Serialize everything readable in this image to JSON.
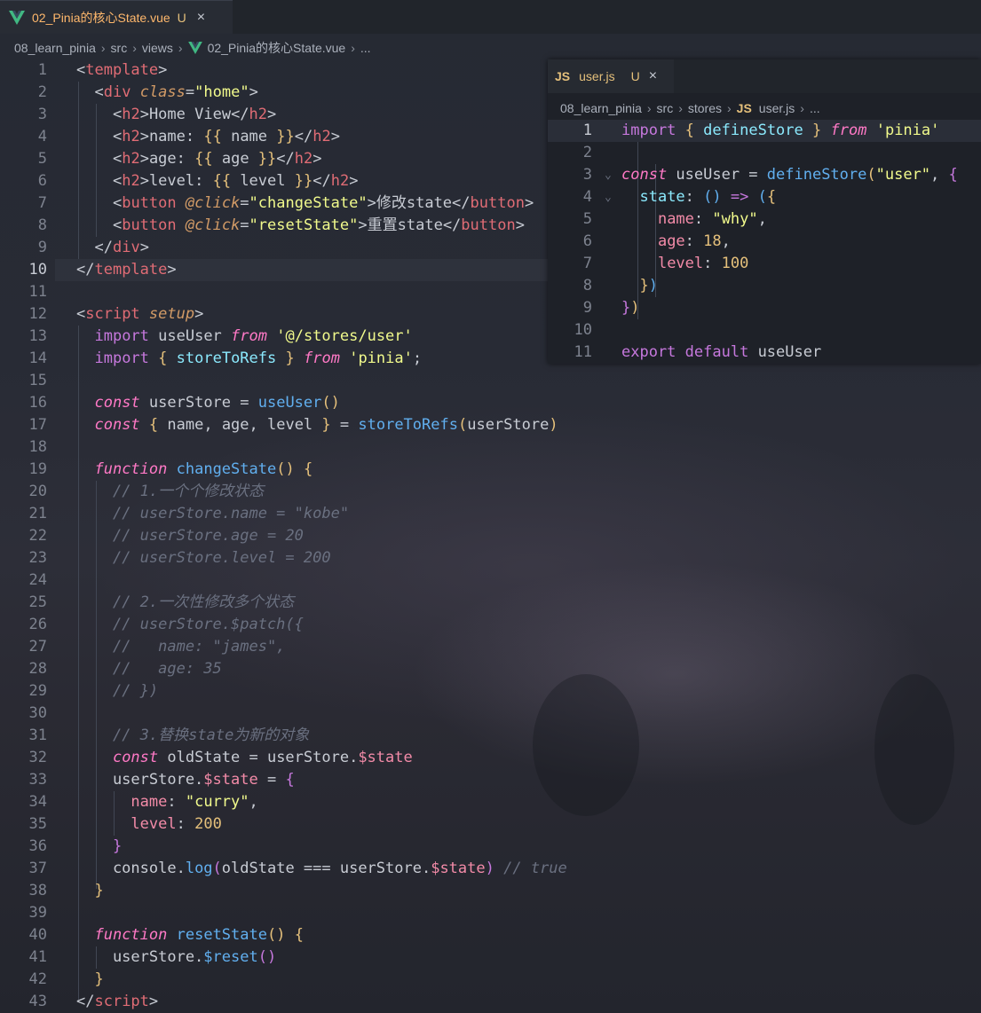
{
  "main_tab": {
    "title": "02_Pinia的核心State.vue",
    "status": "U",
    "close": "×"
  },
  "breadcrumb": [
    "08_learn_pinia",
    "src",
    "views",
    "02_Pinia的核心State.vue",
    "..."
  ],
  "side_tab": {
    "title": "user.js",
    "status": "U",
    "close": "×",
    "icon": "JS"
  },
  "side_breadcrumb": [
    "08_learn_pinia",
    "src",
    "stores",
    "user.js",
    "..."
  ],
  "icons": {
    "vue": "vue-logo-icon",
    "js": "js-file-icon"
  },
  "colors": {
    "background": "#282c34",
    "tag": "#e06c75",
    "string": "#f1fa8c",
    "keyword": "#ff79c6",
    "function": "#61afef",
    "comment": "#6a7080"
  },
  "main_lines": [
    {
      "n": "1",
      "t": [
        [
          "br",
          "<"
        ],
        [
          "tag",
          "template"
        ],
        [
          "br",
          ">"
        ]
      ]
    },
    {
      "n": "2",
      "t": [
        [
          "plain",
          "  "
        ],
        [
          "br",
          "<"
        ],
        [
          "tag",
          "div"
        ],
        [
          "plain",
          " "
        ],
        [
          "attr",
          "class"
        ],
        [
          "br",
          "="
        ],
        [
          "str",
          "\"home\""
        ],
        [
          "br",
          ">"
        ]
      ]
    },
    {
      "n": "3",
      "t": [
        [
          "plain",
          "    "
        ],
        [
          "br",
          "<"
        ],
        [
          "tag",
          "h2"
        ],
        [
          "br",
          ">"
        ],
        [
          "plain",
          "Home View"
        ],
        [
          "br",
          "</"
        ],
        [
          "tag",
          "h2"
        ],
        [
          "br",
          ">"
        ]
      ]
    },
    {
      "n": "4",
      "t": [
        [
          "plain",
          "    "
        ],
        [
          "br",
          "<"
        ],
        [
          "tag",
          "h2"
        ],
        [
          "br",
          ">"
        ],
        [
          "plain",
          "name: "
        ],
        [
          "yellow",
          "{{"
        ],
        [
          "plain",
          " name "
        ],
        [
          "yellow",
          "}}"
        ],
        [
          "br",
          "</"
        ],
        [
          "tag",
          "h2"
        ],
        [
          "br",
          ">"
        ]
      ]
    },
    {
      "n": "5",
      "t": [
        [
          "plain",
          "    "
        ],
        [
          "br",
          "<"
        ],
        [
          "tag",
          "h2"
        ],
        [
          "br",
          ">"
        ],
        [
          "plain",
          "age: "
        ],
        [
          "yellow",
          "{{"
        ],
        [
          "plain",
          " age "
        ],
        [
          "yellow",
          "}}"
        ],
        [
          "br",
          "</"
        ],
        [
          "tag",
          "h2"
        ],
        [
          "br",
          ">"
        ]
      ]
    },
    {
      "n": "6",
      "t": [
        [
          "plain",
          "    "
        ],
        [
          "br",
          "<"
        ],
        [
          "tag",
          "h2"
        ],
        [
          "br",
          ">"
        ],
        [
          "plain",
          "level: "
        ],
        [
          "yellow",
          "{{"
        ],
        [
          "plain",
          " level "
        ],
        [
          "yellow",
          "}}"
        ],
        [
          "br",
          "</"
        ],
        [
          "tag",
          "h2"
        ],
        [
          "br",
          ">"
        ]
      ]
    },
    {
      "n": "7",
      "t": [
        [
          "plain",
          "    "
        ],
        [
          "br",
          "<"
        ],
        [
          "tag",
          "button"
        ],
        [
          "plain",
          " "
        ],
        [
          "attr",
          "@click"
        ],
        [
          "br",
          "="
        ],
        [
          "str",
          "\"changeState\""
        ],
        [
          "br",
          ">"
        ],
        [
          "plain",
          "修改state"
        ],
        [
          "br",
          "</"
        ],
        [
          "tag",
          "button"
        ],
        [
          "br",
          ">"
        ]
      ]
    },
    {
      "n": "8",
      "t": [
        [
          "plain",
          "    "
        ],
        [
          "br",
          "<"
        ],
        [
          "tag",
          "button"
        ],
        [
          "plain",
          " "
        ],
        [
          "attr",
          "@click"
        ],
        [
          "br",
          "="
        ],
        [
          "str",
          "\"resetState\""
        ],
        [
          "br",
          ">"
        ],
        [
          "plain",
          "重置state"
        ],
        [
          "br",
          "</"
        ],
        [
          "tag",
          "button"
        ],
        [
          "br",
          ">"
        ]
      ]
    },
    {
      "n": "9",
      "t": [
        [
          "plain",
          "  "
        ],
        [
          "br",
          "</"
        ],
        [
          "tag",
          "div"
        ],
        [
          "br",
          ">"
        ]
      ]
    },
    {
      "n": "10",
      "t": [
        [
          "br",
          "</"
        ],
        [
          "tag",
          "template"
        ],
        [
          "br",
          ">"
        ]
      ]
    },
    {
      "n": "11",
      "t": []
    },
    {
      "n": "12",
      "t": [
        [
          "br",
          "<"
        ],
        [
          "tag",
          "script"
        ],
        [
          "plain",
          " "
        ],
        [
          "attr",
          "setup"
        ],
        [
          "br",
          ">"
        ]
      ]
    },
    {
      "n": "13",
      "t": [
        [
          "plain",
          "  "
        ],
        [
          "kw2",
          "import"
        ],
        [
          "plain",
          " useUser "
        ],
        [
          "kw",
          "from"
        ],
        [
          "plain",
          " "
        ],
        [
          "str",
          "'@/stores/user'"
        ]
      ]
    },
    {
      "n": "14",
      "t": [
        [
          "plain",
          "  "
        ],
        [
          "kw2",
          "import"
        ],
        [
          "plain",
          " "
        ],
        [
          "yellow",
          "{"
        ],
        [
          "plain",
          " "
        ],
        [
          "fn2",
          "storeToRefs"
        ],
        [
          "plain",
          " "
        ],
        [
          "yellow",
          "}"
        ],
        [
          "plain",
          " "
        ],
        [
          "kw",
          "from"
        ],
        [
          "plain",
          " "
        ],
        [
          "str",
          "'pinia'"
        ],
        [
          "plain",
          ";"
        ]
      ]
    },
    {
      "n": "15",
      "t": []
    },
    {
      "n": "16",
      "t": [
        [
          "plain",
          "  "
        ],
        [
          "kw",
          "const"
        ],
        [
          "plain",
          " userStore = "
        ],
        [
          "fn",
          "useUser"
        ],
        [
          "yellow",
          "()"
        ]
      ]
    },
    {
      "n": "17",
      "t": [
        [
          "plain",
          "  "
        ],
        [
          "kw",
          "const"
        ],
        [
          "plain",
          " "
        ],
        [
          "yellow",
          "{"
        ],
        [
          "plain",
          " name, age, level "
        ],
        [
          "yellow",
          "}"
        ],
        [
          "plain",
          " = "
        ],
        [
          "fn",
          "storeToRefs"
        ],
        [
          "yellow",
          "("
        ],
        [
          "plain",
          "userStore"
        ],
        [
          "yellow",
          ")"
        ]
      ]
    },
    {
      "n": "18",
      "t": []
    },
    {
      "n": "19",
      "t": [
        [
          "plain",
          "  "
        ],
        [
          "kw",
          "function"
        ],
        [
          "plain",
          " "
        ],
        [
          "fn",
          "changeState"
        ],
        [
          "yellow",
          "()"
        ],
        [
          "plain",
          " "
        ],
        [
          "yellow",
          "{"
        ]
      ]
    },
    {
      "n": "20",
      "t": [
        [
          "plain",
          "    "
        ],
        [
          "cm",
          "// 1.一个个修改状态"
        ]
      ]
    },
    {
      "n": "21",
      "t": [
        [
          "plain",
          "    "
        ],
        [
          "cm",
          "// userStore.name = \"kobe\""
        ]
      ]
    },
    {
      "n": "22",
      "t": [
        [
          "plain",
          "    "
        ],
        [
          "cm",
          "// userStore.age = 20"
        ]
      ]
    },
    {
      "n": "23",
      "t": [
        [
          "plain",
          "    "
        ],
        [
          "cm",
          "// userStore.level = 200"
        ]
      ]
    },
    {
      "n": "24",
      "t": []
    },
    {
      "n": "25",
      "t": [
        [
          "plain",
          "    "
        ],
        [
          "cm",
          "// 2.一次性修改多个状态"
        ]
      ]
    },
    {
      "n": "26",
      "t": [
        [
          "plain",
          "    "
        ],
        [
          "cm",
          "// userStore.$patch({"
        ]
      ]
    },
    {
      "n": "27",
      "t": [
        [
          "plain",
          "    "
        ],
        [
          "cm",
          "//   name: \"james\","
        ]
      ]
    },
    {
      "n": "28",
      "t": [
        [
          "plain",
          "    "
        ],
        [
          "cm",
          "//   age: 35"
        ]
      ]
    },
    {
      "n": "29",
      "t": [
        [
          "plain",
          "    "
        ],
        [
          "cm",
          "// })"
        ]
      ]
    },
    {
      "n": "30",
      "t": []
    },
    {
      "n": "31",
      "t": [
        [
          "plain",
          "    "
        ],
        [
          "cm",
          "// 3.替换state为新的对象"
        ]
      ]
    },
    {
      "n": "32",
      "t": [
        [
          "plain",
          "    "
        ],
        [
          "kw",
          "const"
        ],
        [
          "plain",
          " oldState = userStore."
        ],
        [
          "prop",
          "$state"
        ]
      ]
    },
    {
      "n": "33",
      "t": [
        [
          "plain",
          "    userStore."
        ],
        [
          "prop",
          "$state"
        ],
        [
          "plain",
          " = "
        ],
        [
          "kw2",
          "{"
        ]
      ]
    },
    {
      "n": "34",
      "t": [
        [
          "plain",
          "      "
        ],
        [
          "prop",
          "name"
        ],
        [
          "plain",
          ": "
        ],
        [
          "str",
          "\"curry\""
        ],
        [
          "plain",
          ","
        ]
      ]
    },
    {
      "n": "35",
      "t": [
        [
          "plain",
          "      "
        ],
        [
          "prop",
          "level"
        ],
        [
          "plain",
          ": "
        ],
        [
          "num",
          "200"
        ]
      ]
    },
    {
      "n": "36",
      "t": [
        [
          "plain",
          "    "
        ],
        [
          "kw2",
          "}"
        ]
      ]
    },
    {
      "n": "37",
      "t": [
        [
          "plain",
          "    console."
        ],
        [
          "fn",
          "log"
        ],
        [
          "kw2",
          "("
        ],
        [
          "plain",
          "oldState === userStore."
        ],
        [
          "prop",
          "$state"
        ],
        [
          "kw2",
          ")"
        ],
        [
          "plain",
          " "
        ],
        [
          "cm",
          "// true"
        ]
      ]
    },
    {
      "n": "38",
      "t": [
        [
          "plain",
          "  "
        ],
        [
          "yellow",
          "}"
        ]
      ]
    },
    {
      "n": "39",
      "t": []
    },
    {
      "n": "40",
      "t": [
        [
          "plain",
          "  "
        ],
        [
          "kw",
          "function"
        ],
        [
          "plain",
          " "
        ],
        [
          "fn",
          "resetState"
        ],
        [
          "yellow",
          "()"
        ],
        [
          "plain",
          " "
        ],
        [
          "yellow",
          "{"
        ]
      ]
    },
    {
      "n": "41",
      "t": [
        [
          "plain",
          "    userStore."
        ],
        [
          "fn",
          "$reset"
        ],
        [
          "kw2",
          "()"
        ]
      ]
    },
    {
      "n": "42",
      "t": [
        [
          "plain",
          "  "
        ],
        [
          "yellow",
          "}"
        ]
      ]
    },
    {
      "n": "43",
      "t": [
        [
          "br",
          "</"
        ],
        [
          "tag",
          "script"
        ],
        [
          "br",
          ">"
        ]
      ]
    }
  ],
  "side_lines": [
    {
      "n": "1",
      "t": [
        [
          "kw2",
          "import"
        ],
        [
          "plain",
          " "
        ],
        [
          "yellow",
          "{"
        ],
        [
          "plain",
          " "
        ],
        [
          "fn2",
          "defineStore"
        ],
        [
          "plain",
          " "
        ],
        [
          "yellow",
          "}"
        ],
        [
          "plain",
          " "
        ],
        [
          "kw",
          "from"
        ],
        [
          "plain",
          " "
        ],
        [
          "str",
          "'pinia'"
        ]
      ]
    },
    {
      "n": "2",
      "t": []
    },
    {
      "n": "3",
      "t": [
        [
          "kw",
          "const"
        ],
        [
          "plain",
          " useUser = "
        ],
        [
          "fn",
          "defineStore"
        ],
        [
          "yellow",
          "("
        ],
        [
          "str",
          "\"user\""
        ],
        [
          "plain",
          ", "
        ],
        [
          "kw2",
          "{"
        ]
      ]
    },
    {
      "n": "4",
      "t": [
        [
          "plain",
          "  "
        ],
        [
          "fn2",
          "state"
        ],
        [
          "plain",
          ": "
        ],
        [
          "fn",
          "()"
        ],
        [
          "plain",
          " "
        ],
        [
          "kw2",
          "=>"
        ],
        [
          "plain",
          " "
        ],
        [
          "fn",
          "("
        ],
        [
          "yellow",
          "{"
        ]
      ]
    },
    {
      "n": "5",
      "t": [
        [
          "plain",
          "    "
        ],
        [
          "prop",
          "name"
        ],
        [
          "plain",
          ": "
        ],
        [
          "str",
          "\"why\""
        ],
        [
          "plain",
          ","
        ]
      ]
    },
    {
      "n": "6",
      "t": [
        [
          "plain",
          "    "
        ],
        [
          "prop",
          "age"
        ],
        [
          "plain",
          ": "
        ],
        [
          "num",
          "18"
        ],
        [
          "plain",
          ","
        ]
      ]
    },
    {
      "n": "7",
      "t": [
        [
          "plain",
          "    "
        ],
        [
          "prop",
          "level"
        ],
        [
          "plain",
          ": "
        ],
        [
          "num",
          "100"
        ]
      ]
    },
    {
      "n": "8",
      "t": [
        [
          "plain",
          "  "
        ],
        [
          "yellow",
          "}"
        ],
        [
          "fn",
          ")"
        ]
      ]
    },
    {
      "n": "9",
      "t": [
        [
          "kw2",
          "}"
        ],
        [
          "yellow",
          ")"
        ]
      ]
    },
    {
      "n": "10",
      "t": []
    },
    {
      "n": "11",
      "t": [
        [
          "kw2",
          "export"
        ],
        [
          "plain",
          " "
        ],
        [
          "kw2",
          "default"
        ],
        [
          "plain",
          " useUser"
        ]
      ]
    }
  ]
}
